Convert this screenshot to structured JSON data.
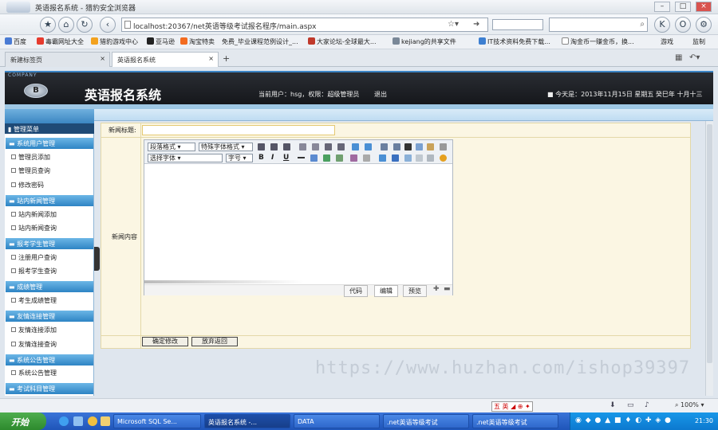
{
  "browser": {
    "title": "英语报名系统 - 猎豹安全浏览器",
    "url": "localhost:20367/net英语等级考试报名程序/main.aspx",
    "bookmarks": [
      "百度",
      "毒霸网址大全",
      "猎豹游戏中心",
      "亚马逊",
      "淘宝特卖",
      "免费_毕业课程范例设计_...",
      "大家论坛-全球最大...",
      "kejiang的共享文件",
      "IT技术资料免费下载...",
      "淘金币一赚金币，换..."
    ],
    "bookmarks_right": [
      "游戏",
      "监制"
    ],
    "tabs": [
      {
        "label": "新建标签页"
      },
      {
        "label": "英语报名系统"
      }
    ],
    "zoom": "100%"
  },
  "app": {
    "company": "COMPANY",
    "title": "英语报名系统",
    "current_user": "当前用户：hsg，权限：超级管理员",
    "logout": "退出",
    "date": "今天是：2013年11月15日 星期五 癸巳年 十月十三",
    "menu_title": "管理菜单"
  },
  "sidebar": {
    "sections": [
      {
        "title": "系统用户管理",
        "items": [
          "管理员添加",
          "管理员查询",
          "修改密码"
        ]
      },
      {
        "title": "站内新闻管理",
        "items": [
          "站内新闻添加",
          "站内新闻查询"
        ]
      },
      {
        "title": "报考学生管理",
        "items": [
          "注册用户查询",
          "报考学生查询"
        ]
      },
      {
        "title": "成绩管理",
        "items": [
          "考生成绩管理"
        ]
      },
      {
        "title": "友情连接管理",
        "items": [
          "友情连接添加",
          "友情连接查询"
        ]
      },
      {
        "title": "系统公告管理",
        "items": [
          "系统公告管理"
        ]
      },
      {
        "title": "考试科目管理",
        "items": []
      }
    ]
  },
  "form": {
    "title_label": "新闻标题:",
    "content_label": "新闻内容",
    "editor": {
      "paragraph": "段落格式",
      "font_format": "特殊字体格式",
      "font": "选择字体",
      "size": "字号",
      "modes": [
        "代码",
        "编辑",
        "预览"
      ]
    },
    "submit": "确定修改",
    "cancel": "放弃返回"
  },
  "watermark": "https://www.huzhan.com/ishop39397",
  "taskbar": {
    "start": "开始",
    "tasks": [
      "Microsoft SQL Se...",
      "英语报名系统 -...",
      "DATA",
      ".net英语等级考试",
      ".net英语等级考试"
    ],
    "clock": "21:30"
  }
}
